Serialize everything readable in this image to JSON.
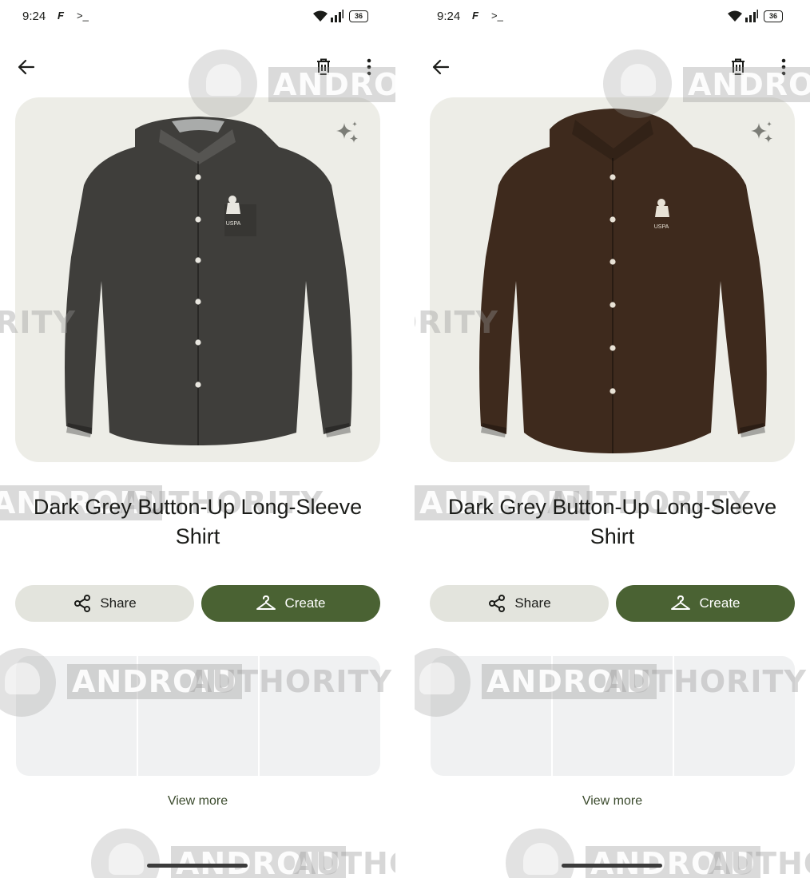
{
  "screens": [
    {
      "id": "left",
      "status": {
        "time": "9:24",
        "battery": "36"
      },
      "product": {
        "title": "Dark Grey Button-Up Long-Sleeve Shirt",
        "shirt_color": "#3f3e3b",
        "logo_text": "USPA"
      },
      "actions": {
        "share_label": "Share",
        "create_label": "Create"
      },
      "view_more_label": "View more"
    },
    {
      "id": "right",
      "status": {
        "time": "9:24",
        "battery": "36"
      },
      "product": {
        "title": "Dark Grey Button-Up Long-Sleeve Shirt",
        "shirt_color": "#3e2a1d",
        "logo_text": "USPA"
      },
      "actions": {
        "share_label": "Share",
        "create_label": "Create"
      },
      "view_more_label": "View more"
    }
  ],
  "watermark": {
    "word_a": "ANDROID",
    "word_b": "AUTHORITY"
  },
  "colors": {
    "create_button": "#4a6233",
    "share_button": "#e3e4dd",
    "card_background": "#ededE7"
  },
  "icons": [
    "back-arrow-icon",
    "trash-icon",
    "more-vert-icon",
    "sparkle-icon",
    "share-icon",
    "hanger-icon",
    "wifi-icon",
    "signal-icon",
    "battery-icon"
  ]
}
